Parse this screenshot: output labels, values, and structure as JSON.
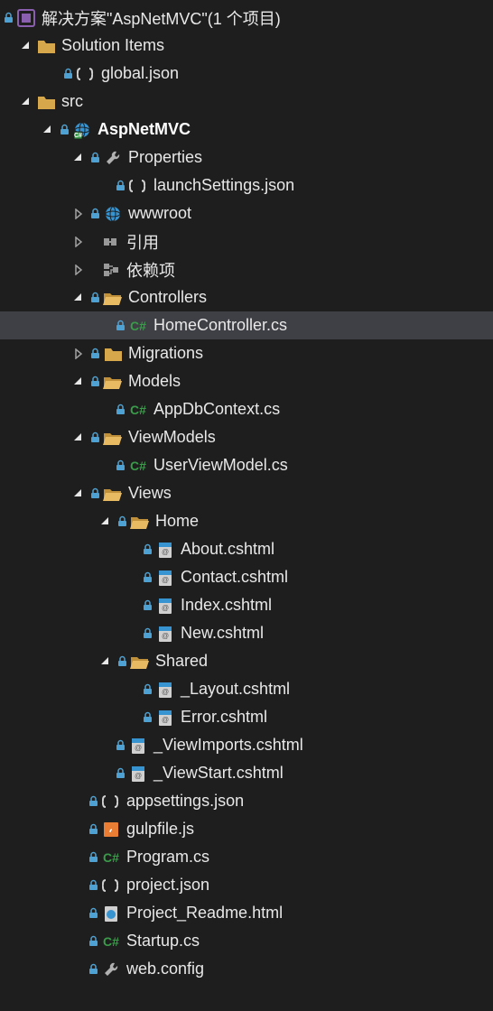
{
  "solution": {
    "title": "解决方案\"AspNetMVC\"(1 个项目)",
    "solutionItems": "Solution Items",
    "globalJson": "global.json",
    "src": "src",
    "project": "AspNetMVC",
    "properties": "Properties",
    "launchSettings": "launchSettings.json",
    "wwwroot": "wwwroot",
    "references": "引用",
    "dependencies": "依赖项",
    "controllers": "Controllers",
    "homeController": "HomeController.cs",
    "migrations": "Migrations",
    "models": "Models",
    "appDbContext": "AppDbContext.cs",
    "viewModels": "ViewModels",
    "userViewModel": "UserViewModel.cs",
    "views": "Views",
    "home": "Home",
    "about": "About.cshtml",
    "contact": "Contact.cshtml",
    "index": "Index.cshtml",
    "new": "New.cshtml",
    "shared": "Shared",
    "layout": "_Layout.cshtml",
    "error": "Error.cshtml",
    "viewImports": "_ViewImports.cshtml",
    "viewStart": "_ViewStart.cshtml",
    "appsettings": "appsettings.json",
    "gulpfile": "gulpfile.js",
    "program": "Program.cs",
    "projectJson": "project.json",
    "projectReadme": "Project_Readme.html",
    "startup": "Startup.cs",
    "webConfig": "web.config"
  }
}
